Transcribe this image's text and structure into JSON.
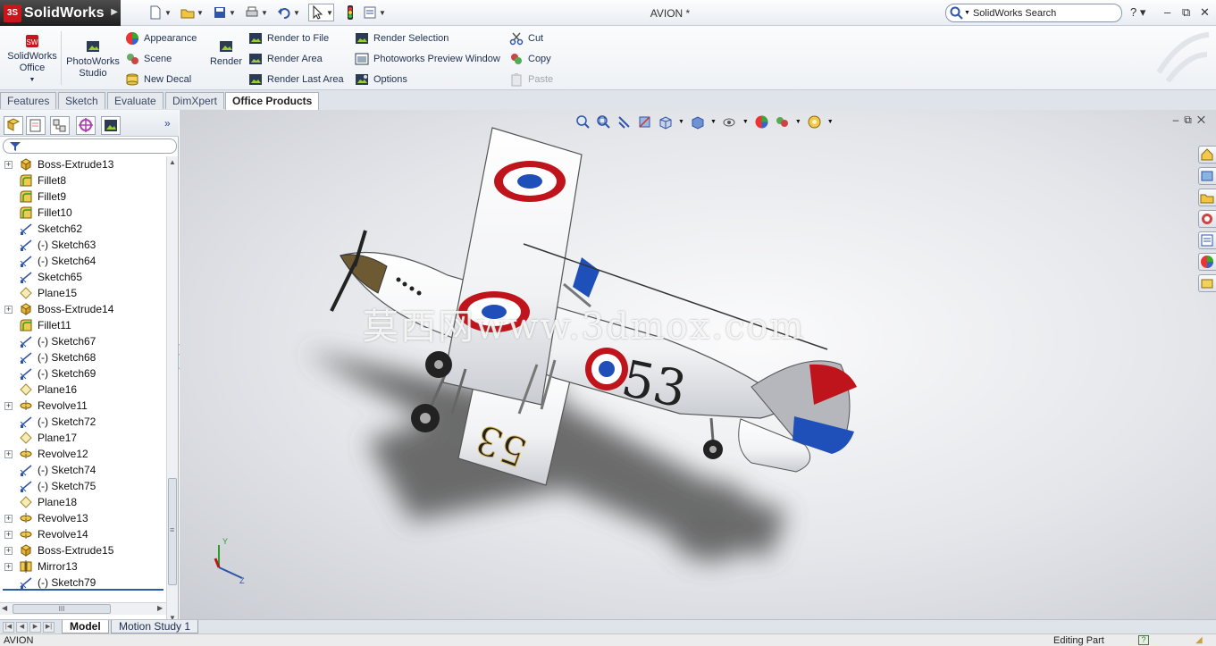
{
  "app": {
    "brand": "SolidWorks",
    "doc_title": "AVION *"
  },
  "search": {
    "placeholder": "SolidWorks Search"
  },
  "ribbon": {
    "solidworks_office": [
      "SolidWorks",
      "Office"
    ],
    "photoworks_studio": [
      "PhotoWorks",
      "Studio"
    ],
    "appearance": "Appearance",
    "scene": "Scene",
    "new_decal": "New Decal",
    "render": "Render",
    "render_to_file": "Render to File",
    "render_area": "Render Area",
    "render_last_area": "Render Last Area",
    "render_selection": "Render Selection",
    "photoworks_preview_window": "Photoworks Preview Window",
    "options": "Options",
    "cut": "Cut",
    "copy": "Copy",
    "paste": "Paste"
  },
  "tabs": [
    "Features",
    "Sketch",
    "Evaluate",
    "DimXpert",
    "Office Products"
  ],
  "active_tab": "Office Products",
  "tree": [
    {
      "label": "Boss-Extrude13",
      "icon": "boss-extrude-icon",
      "expandable": true
    },
    {
      "label": "Fillet8",
      "icon": "fillet-icon",
      "expandable": false
    },
    {
      "label": "Fillet9",
      "icon": "fillet-icon",
      "expandable": false
    },
    {
      "label": "Fillet10",
      "icon": "fillet-icon",
      "expandable": false
    },
    {
      "label": "Sketch62",
      "icon": "sketch-icon",
      "expandable": false
    },
    {
      "label": "(-) Sketch63",
      "icon": "sketch-icon",
      "expandable": false
    },
    {
      "label": "(-) Sketch64",
      "icon": "sketch-icon",
      "expandable": false
    },
    {
      "label": "Sketch65",
      "icon": "sketch-icon",
      "expandable": false
    },
    {
      "label": "Plane15",
      "icon": "plane-icon",
      "expandable": false
    },
    {
      "label": "Boss-Extrude14",
      "icon": "boss-extrude-icon",
      "expandable": true
    },
    {
      "label": "Fillet11",
      "icon": "fillet-icon",
      "expandable": false
    },
    {
      "label": "(-) Sketch67",
      "icon": "sketch-icon",
      "expandable": false
    },
    {
      "label": "(-) Sketch68",
      "icon": "sketch-icon",
      "expandable": false
    },
    {
      "label": "(-) Sketch69",
      "icon": "sketch-icon",
      "expandable": false
    },
    {
      "label": "Plane16",
      "icon": "plane-icon",
      "expandable": false
    },
    {
      "label": "Revolve11",
      "icon": "revolve-icon",
      "expandable": true
    },
    {
      "label": "(-) Sketch72",
      "icon": "sketch-icon",
      "expandable": false
    },
    {
      "label": "Plane17",
      "icon": "plane-icon",
      "expandable": false
    },
    {
      "label": "Revolve12",
      "icon": "revolve-icon",
      "expandable": true
    },
    {
      "label": "(-) Sketch74",
      "icon": "sketch-icon",
      "expandable": false
    },
    {
      "label": "(-) Sketch75",
      "icon": "sketch-icon",
      "expandable": false
    },
    {
      "label": "Plane18",
      "icon": "plane-icon",
      "expandable": false
    },
    {
      "label": "Revolve13",
      "icon": "revolve-icon",
      "expandable": true
    },
    {
      "label": "Revolve14",
      "icon": "revolve-icon",
      "expandable": true
    },
    {
      "label": "Boss-Extrude15",
      "icon": "boss-extrude-icon",
      "expandable": true
    },
    {
      "label": "Mirror13",
      "icon": "mirror-icon",
      "expandable": true
    },
    {
      "label": "(-) Sketch79",
      "icon": "sketch-icon",
      "expandable": false
    }
  ],
  "hscroll_thumb": "III",
  "watermark": "莫西网www.3dmox.com",
  "model": {
    "decal_number": "53",
    "triad_axes": [
      "Y",
      "Z"
    ]
  },
  "bottom_tabs": [
    "Model",
    "Motion Study 1"
  ],
  "status": {
    "left": "AVION",
    "right": "Editing Part"
  },
  "colors": {
    "roundel_red": "#c0141c",
    "roundel_blue": "#1f4fb8",
    "accent_blue": "#2a5ca8"
  }
}
